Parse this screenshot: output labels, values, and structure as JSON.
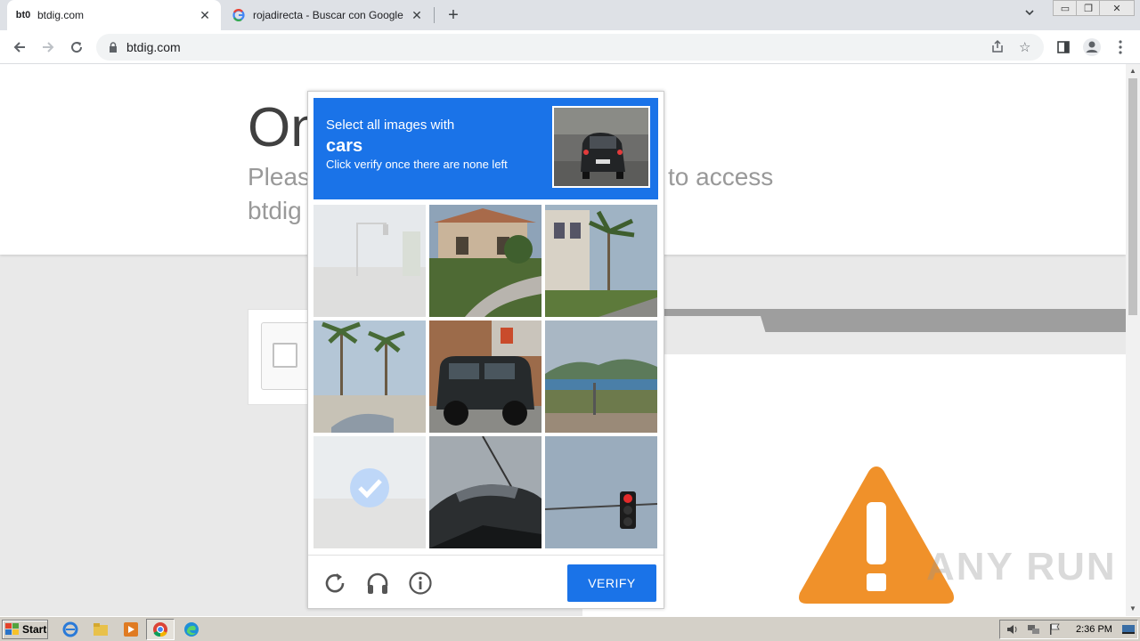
{
  "browser": {
    "tabs": [
      {
        "label": "btdig.com",
        "favicon": "bt0",
        "active": true
      },
      {
        "label": "rojadirecta - Buscar con Google",
        "favicon": "google-g",
        "active": false
      }
    ],
    "new_tab": "+",
    "url": "btdig.com"
  },
  "page": {
    "heading": "On",
    "subtitle_line1": "Pleas",
    "subtitle_line2": "btdig",
    "subtitle_right": "to access"
  },
  "captcha": {
    "line1": "Select all images with",
    "target": "cars",
    "line3": "Click verify once there are none left",
    "verify_label": "VERIFY",
    "footer_icons": [
      "reload-icon",
      "audio-icon",
      "info-icon"
    ],
    "tiles": [
      {
        "subject": "street-lamp-faded",
        "state": "faded"
      },
      {
        "subject": "house-driveway",
        "state": "normal"
      },
      {
        "subject": "palm-building",
        "state": "normal"
      },
      {
        "subject": "palm-street",
        "state": "normal"
      },
      {
        "subject": "jeep",
        "state": "normal"
      },
      {
        "subject": "coast",
        "state": "normal"
      },
      {
        "subject": "selected-check",
        "state": "faded-selected"
      },
      {
        "subject": "car-roof",
        "state": "normal"
      },
      {
        "subject": "traffic-light",
        "state": "normal"
      }
    ]
  },
  "watermark": "ANY RUN",
  "taskbar": {
    "start_label": "Start",
    "clock": "2:36 PM"
  },
  "colors": {
    "captcha_blue": "#1a73e8",
    "warning_orange": "#f0912a"
  }
}
